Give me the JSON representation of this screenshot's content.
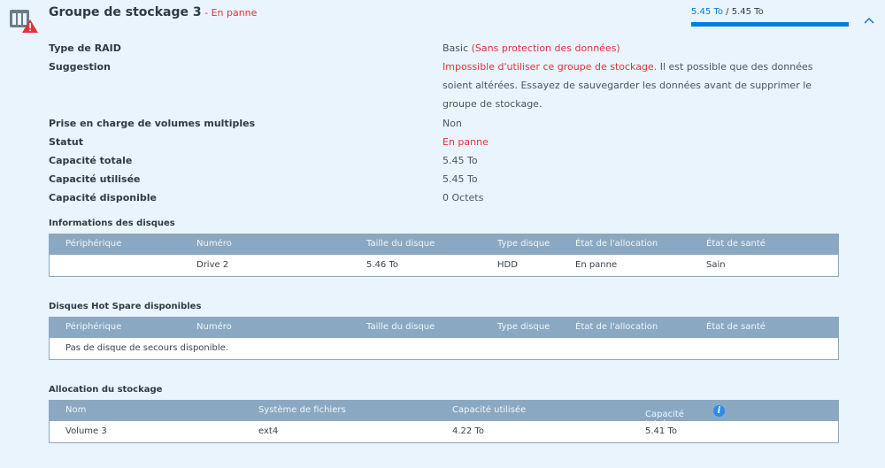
{
  "header": {
    "title": "Groupe de stockage 3",
    "separator": " - ",
    "status": "En panne",
    "capacity_used": "5.45 To",
    "capacity_sep": " / ",
    "capacity_total": "5.45 To",
    "capacity_fraction": 1.0,
    "collapse_icon": "chevron-up-icon",
    "storage_icon": "storage-pool-error-icon"
  },
  "properties": {
    "raid_type": {
      "label": "Type de RAID",
      "value": "Basic",
      "value_note": "(Sans protection des données)"
    },
    "suggestion": {
      "label": "Suggestion",
      "value_red": "Impossible d'utiliser ce groupe de stockage.",
      "value_rest": " Il est possible que des données soient altérées. Essayez de sauvegarder les données avant de supprimer le groupe de stockage."
    },
    "multi_volume": {
      "label": "Prise en charge de volumes multiples",
      "value": "Non"
    },
    "status": {
      "label": "Statut",
      "value": "En panne"
    },
    "total_capacity": {
      "label": "Capacité totale",
      "value": "5.45 To"
    },
    "used_capacity": {
      "label": "Capacité utilisée",
      "value": "5.45 To"
    },
    "available_capacity": {
      "label": "Capacité disponible",
      "value": "0 Octets"
    }
  },
  "disks": {
    "title": "Informations des disques",
    "headers": [
      "Périphérique",
      "Numéro",
      "Taille du disque",
      "Type disque",
      "État de l'allocation",
      "État de santé"
    ],
    "rows": [
      {
        "device": "",
        "number": "Drive 2",
        "size": "5.46 To",
        "type": "HDD",
        "allocation": "En panne",
        "health": "Sain"
      }
    ]
  },
  "hot_spare": {
    "title": "Disques Hot Spare disponibles",
    "headers": [
      "Périphérique",
      "Numéro",
      "Taille du disque",
      "Type disque",
      "État de l'allocation",
      "État de santé"
    ],
    "empty_message": "Pas de disque de secours disponible."
  },
  "allocation": {
    "title": "Allocation du stockage",
    "headers": [
      "Nom",
      "Système de fichiers",
      "Capacité utilisée",
      "Capacité totale"
    ],
    "info_icon": "info-icon",
    "rows": [
      {
        "name": "Volume 3",
        "filesystem": "ext4",
        "used": "4.22 To",
        "total": "5.41 To"
      }
    ]
  },
  "colors": {
    "accent": "#0080e0",
    "error": "#e0333d",
    "healthy": "#3b9b2f",
    "table_header": "#8aa8c2",
    "panel_bg": "#e9f4fc"
  }
}
